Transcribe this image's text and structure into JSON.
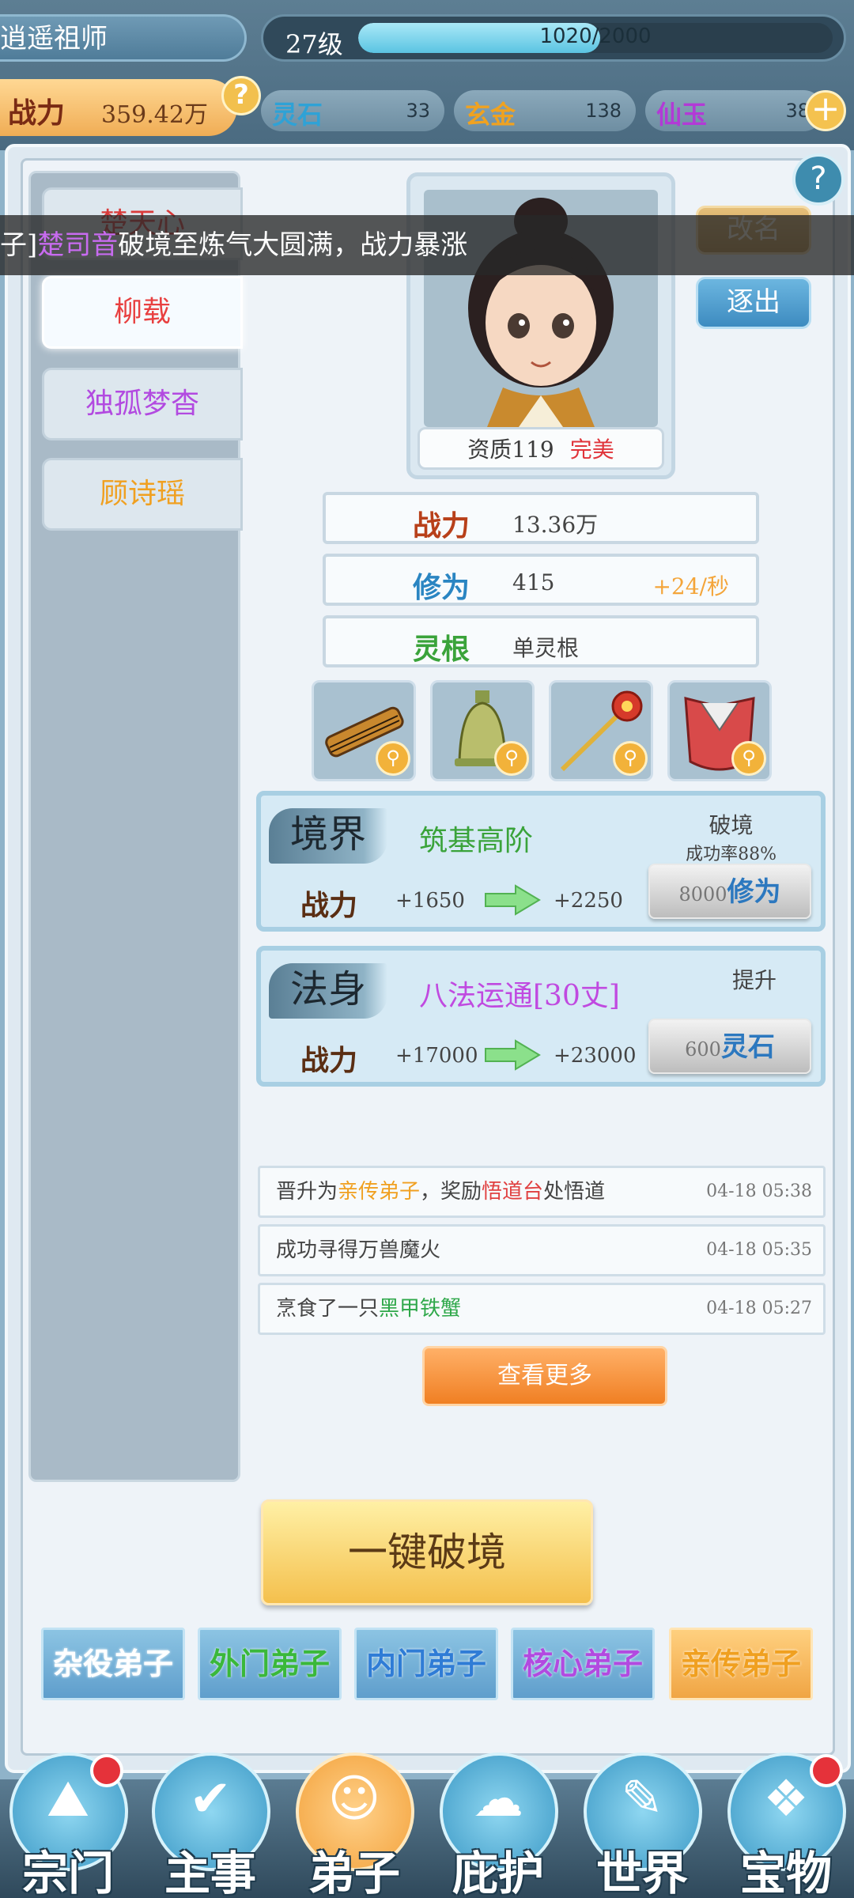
{
  "header": {
    "player_name": "逍遥祖师",
    "level": "27级",
    "exp_text": "1020/2000",
    "exp_fraction": 0.51,
    "power_label": "战力",
    "power_value": "359.42万",
    "help_icon": "question-icon",
    "resources": [
      {
        "label": "灵石",
        "value": "33",
        "color": "#2fa2d6"
      },
      {
        "label": "玄金",
        "value": "138",
        "color": "#f0a220"
      },
      {
        "label": "仙玉",
        "value": "38",
        "color": "#b23ad6"
      }
    ],
    "add_icon": "plus-icon"
  },
  "disciples": [
    {
      "name": "楚天心",
      "color": "#d83a3a",
      "selected": false
    },
    {
      "name": "柳载",
      "color": "#e84040",
      "selected": true
    },
    {
      "name": "独孤梦杳",
      "color": "#b24ae0",
      "selected": false
    },
    {
      "name": "顾诗瑶",
      "color": "#f0a020",
      "selected": false
    }
  ],
  "toast": {
    "prefix": "子]",
    "name": "楚司音",
    "message": "破境至炼气大圆满，战力暴涨"
  },
  "profile": {
    "aptitude_label": "资质119",
    "aptitude_grade": "完美",
    "rename_label": "改名",
    "expel_label": "逐出"
  },
  "stats": [
    {
      "label": "战力",
      "value": "13.36万",
      "rate": "",
      "color": "#b8401a"
    },
    {
      "label": "修为",
      "value": "415",
      "rate": "+24/秒",
      "color": "#2a85c2"
    },
    {
      "label": "灵根",
      "value": "单灵根",
      "rate": "",
      "color": "#3aa33a"
    }
  ],
  "equipment": [
    {
      "name": "guqin-icon"
    },
    {
      "name": "bell-icon"
    },
    {
      "name": "dragon-staff-icon"
    },
    {
      "name": "robe-icon"
    }
  ],
  "realm": {
    "head": "境界",
    "title": "筑基高阶",
    "side_title": "破境",
    "side_sub": "成功率88%",
    "power_label": "战力",
    "from": "+1650",
    "to": "+2250",
    "cost": "8000",
    "currency": "修为"
  },
  "dharma": {
    "head": "法身",
    "title": "八法运通[30丈]",
    "side_title": "提升",
    "power_label": "战力",
    "from": "+17000",
    "to": "+23000",
    "cost": "600",
    "currency": "灵石"
  },
  "logs": [
    {
      "parts": [
        {
          "t": "晋升为",
          "c": "#444"
        },
        {
          "t": "亲传弟子",
          "c": "#f0a020"
        },
        {
          "t": "，奖励",
          "c": "#444"
        },
        {
          "t": "悟道台",
          "c": "#e04040"
        },
        {
          "t": "处悟道",
          "c": "#444"
        }
      ],
      "time": "04-18 05:38"
    },
    {
      "parts": [
        {
          "t": "成功寻得万兽魔火",
          "c": "#444"
        }
      ],
      "time": "04-18 05:35"
    },
    {
      "parts": [
        {
          "t": "烹食了一只",
          "c": "#444"
        },
        {
          "t": "黑甲铁蟹",
          "c": "#2fa84a"
        }
      ],
      "time": "04-18 05:27"
    }
  ],
  "more_label": "查看更多",
  "breakthrough_label": "一键破境",
  "ranks": [
    {
      "label": "杂役弟子",
      "color": "#ffffff",
      "selected": false
    },
    {
      "label": "外门弟子",
      "color": "#3ab83a",
      "selected": false
    },
    {
      "label": "内门弟子",
      "color": "#2f7cd6",
      "selected": false
    },
    {
      "label": "核心弟子",
      "color": "#b24ae0",
      "selected": false
    },
    {
      "label": "亲传弟子",
      "color": "#f0a020",
      "selected": true
    }
  ],
  "nav": [
    {
      "label": "宗门",
      "icon": "sect-icon",
      "glyph": "⛰",
      "badge": true,
      "selected": false
    },
    {
      "label": "主事",
      "icon": "task-icon",
      "glyph": "✔",
      "badge": false,
      "selected": false
    },
    {
      "label": "弟子",
      "icon": "disciple-icon",
      "glyph": "☺",
      "badge": false,
      "selected": true
    },
    {
      "label": "庇护",
      "icon": "protect-icon",
      "glyph": "☁",
      "badge": false,
      "selected": false
    },
    {
      "label": "世界",
      "icon": "world-icon",
      "glyph": "✎",
      "badge": false,
      "selected": false
    },
    {
      "label": "宝物",
      "icon": "treasure-icon",
      "glyph": "❖",
      "badge": true,
      "selected": false
    }
  ]
}
